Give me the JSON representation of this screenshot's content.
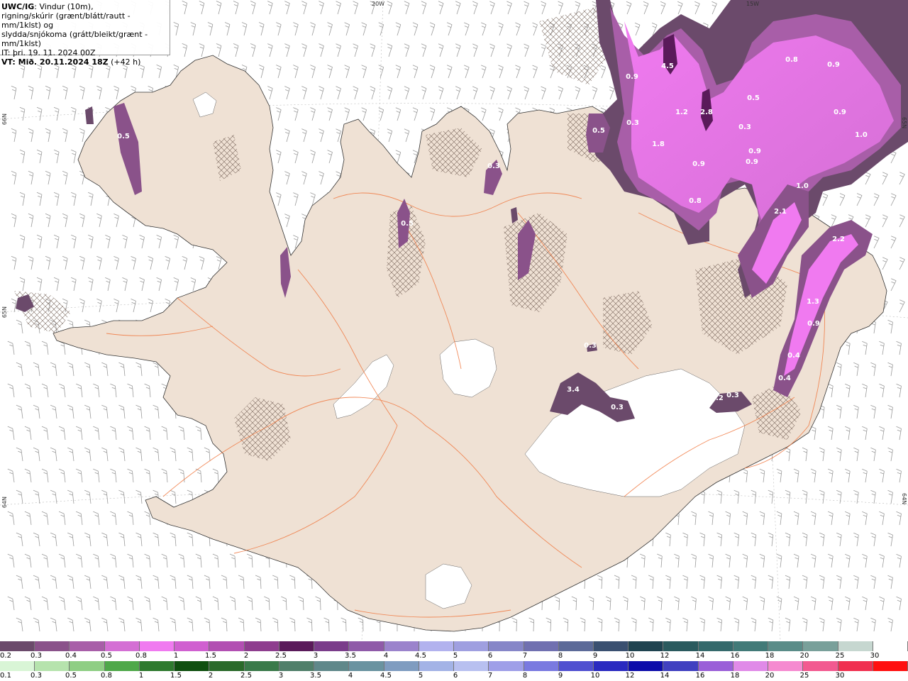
{
  "header": {
    "model": "UWC/IG",
    "line1": ": Vindur (10m),",
    "line2": "rigning/skúrir (grænt/blátt/rautt - mm/1klst) og",
    "line3": "slydda/snjókoma (grátt/bleikt/grænt - mm/1klst)",
    "it": "IT: þri. 19. 11. 2024 00Z",
    "vt_label": "VT: Mið. 20.11.2024 18Z",
    "vt_offset": " (+42 h)"
  },
  "coords": {
    "top_20w": "20W",
    "top_15w": "15W",
    "left_66n": "66N",
    "left_65n": "65N",
    "left_64n": "64N",
    "right_65n": "65N",
    "right_64n": "64N"
  },
  "snow_values": [
    {
      "v": "4.5"
    },
    {
      "v": "0.9"
    },
    {
      "v": "1.2"
    },
    {
      "v": "2.8"
    },
    {
      "v": "0.3"
    },
    {
      "v": "0.5"
    },
    {
      "v": "1.8"
    },
    {
      "v": "0.9"
    },
    {
      "v": "0.8"
    },
    {
      "v": "0.8"
    },
    {
      "v": "0.9"
    },
    {
      "v": "0.5"
    },
    {
      "v": "0.3"
    },
    {
      "v": "0.9"
    },
    {
      "v": "0.9"
    },
    {
      "v": "0.9"
    },
    {
      "v": "1.0"
    },
    {
      "v": "1.0"
    },
    {
      "v": "2.1"
    },
    {
      "v": "2.2"
    },
    {
      "v": "1.3"
    },
    {
      "v": "0.9"
    },
    {
      "v": "0.4"
    },
    {
      "v": "0.4"
    },
    {
      "v": "0.5"
    },
    {
      "v": "0.5"
    },
    {
      "v": "0.3"
    },
    {
      "v": "3.4"
    },
    {
      "v": "0.3"
    },
    {
      "v": "0.2"
    },
    {
      "v": "0.3"
    },
    {
      "v": "0.2"
    },
    {
      "v": "0.3"
    }
  ],
  "legend_snow": {
    "colors": [
      "#6b4a6b",
      "#8a528a",
      "#a85ea8",
      "#d46fd4",
      "#f07af0",
      "#d060d0",
      "#b24fb2",
      "#8e3d8e",
      "#5a1a5a",
      "#7a3c8a",
      "#8f5aa8",
      "#9b83cc",
      "#b2b2ee",
      "#9f9fe0",
      "#8686c8",
      "#7070b0",
      "#5c6a98",
      "#3a5070",
      "#1f4350",
      "#2a5a5e",
      "#356a6c",
      "#427a78",
      "#5a8c88",
      "#79a09a",
      "#c6d7d0",
      "#ffffff"
    ],
    "labels": [
      "0.2",
      "0.3",
      "0.4",
      "0.5",
      "0.8",
      "1",
      "1.5",
      "2",
      "2.5",
      "3",
      "3.5",
      "4",
      "4.5",
      "5",
      "6",
      "7",
      "8",
      "9",
      "10",
      "12",
      "14",
      "16",
      "18",
      "20",
      "25",
      "30"
    ]
  },
  "legend_rain": {
    "colors": [
      "#d9f5d6",
      "#b6e3ad",
      "#8fce84",
      "#4fa84a",
      "#2e7a2e",
      "#0f4f0f",
      "#2a6a2a",
      "#3a7a4a",
      "#507f6a",
      "#60888a",
      "#6a93a0",
      "#7f9cc0",
      "#a3b3e6",
      "#b8c0f0",
      "#9f9fe8",
      "#7a7ae0",
      "#5050d0",
      "#2a2ac0",
      "#0d0daa",
      "#4040c0",
      "#9a5fd8",
      "#e08ae8",
      "#f58ad0",
      "#f25a90",
      "#f03050",
      "#ff1010"
    ],
    "labels": [
      "0.1",
      "0.3",
      "0.5",
      "0.8",
      "1",
      "1.5",
      "2",
      "2.5",
      "3",
      "3.5",
      "4",
      "4.5",
      "5",
      "6",
      "7",
      "8",
      "9",
      "10",
      "12",
      "14",
      "16",
      "18",
      "20",
      "25",
      "30"
    ]
  }
}
